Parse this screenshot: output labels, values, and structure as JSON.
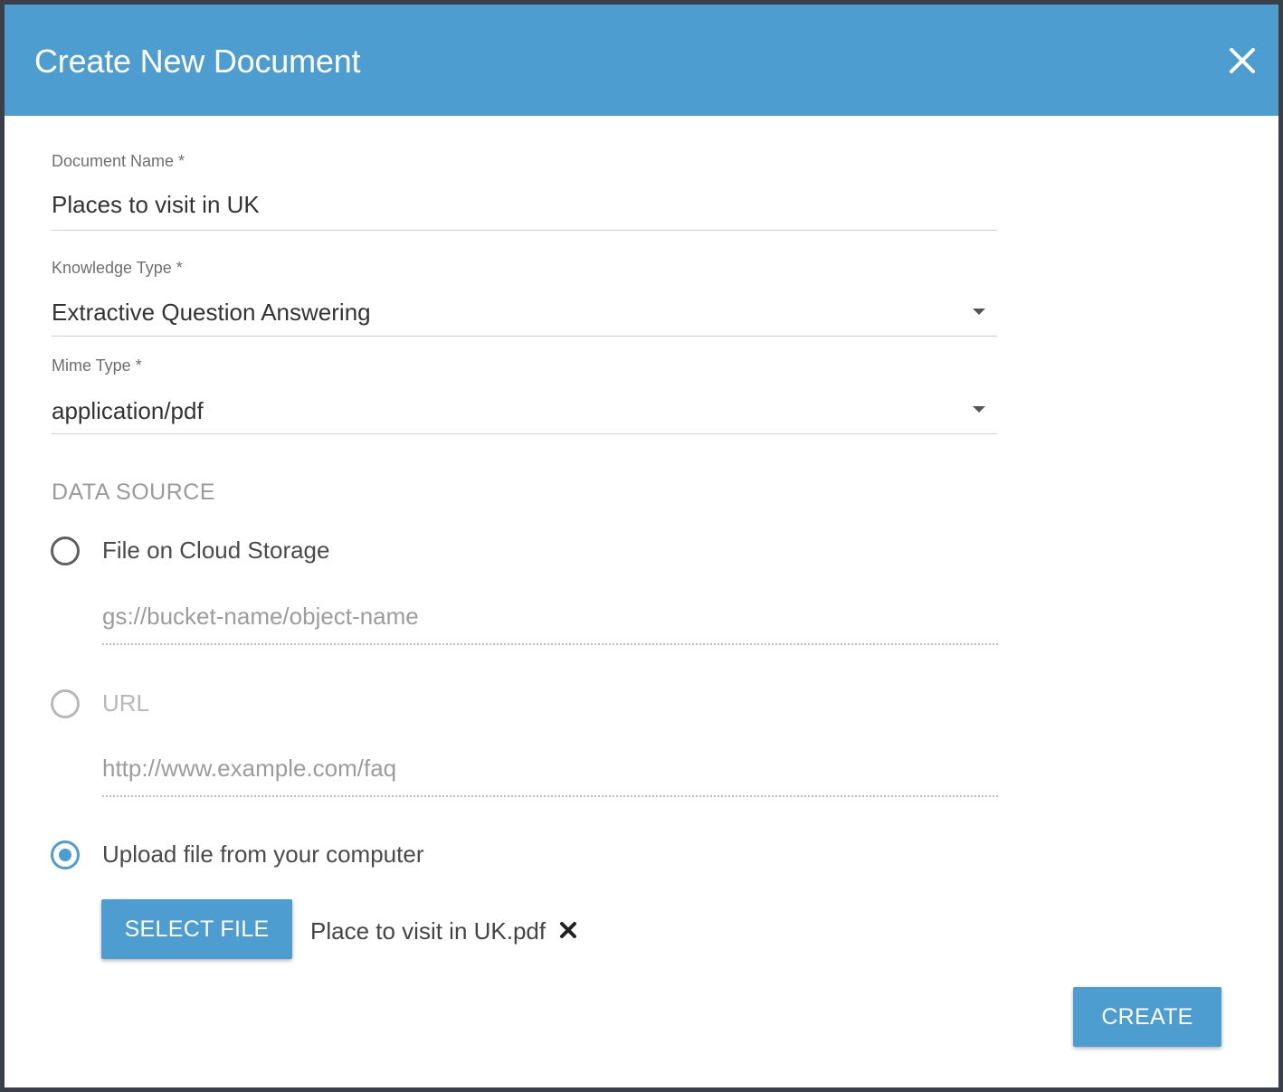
{
  "dialog": {
    "title": "Create New Document",
    "close_icon": "close-icon"
  },
  "fields": {
    "document_name": {
      "label": "Document Name *",
      "value": "Places to visit in UK"
    },
    "knowledge_type": {
      "label": "Knowledge Type *",
      "value": "Extractive Question Answering"
    },
    "mime_type": {
      "label": "Mime Type *",
      "value": "application/pdf"
    }
  },
  "data_source": {
    "heading": "DATA SOURCE",
    "options": [
      {
        "label": "File on Cloud Storage",
        "placeholder": "gs://bucket-name/object-name",
        "selected": false,
        "disabled": false
      },
      {
        "label": "URL",
        "placeholder": "http://www.example.com/faq",
        "selected": false,
        "disabled": true
      },
      {
        "label": "Upload file from your computer",
        "selected": true,
        "disabled": false
      }
    ],
    "select_file_label": "SELECT FILE",
    "selected_file": "Place to visit in UK.pdf",
    "remove_icon": "remove-file-icon"
  },
  "actions": {
    "create_label": "CREATE"
  },
  "colors": {
    "accent": "#4d9dd0",
    "border": "#3a3f4a"
  }
}
